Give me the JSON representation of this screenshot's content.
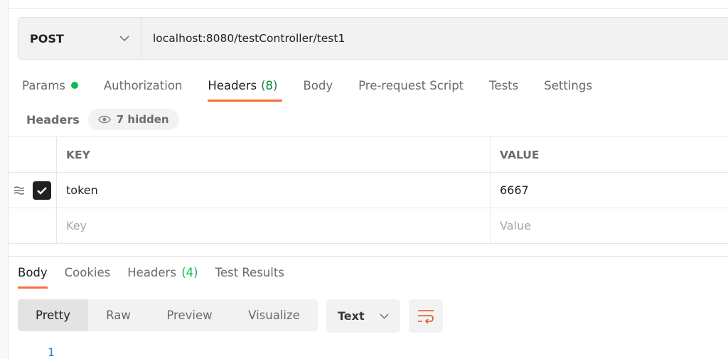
{
  "request": {
    "method": "POST",
    "url": "localhost:8080/testController/test1"
  },
  "tabs": [
    {
      "label": "Params"
    },
    {
      "label": "Authorization"
    },
    {
      "label": "Headers",
      "count": "(8)"
    },
    {
      "label": "Body"
    },
    {
      "label": "Pre-request Script"
    },
    {
      "label": "Tests"
    },
    {
      "label": "Settings"
    }
  ],
  "headers_section": {
    "label": "Headers",
    "hidden": "7 hidden"
  },
  "table": {
    "key_header": "KEY",
    "value_header": "VALUE",
    "rows": [
      {
        "key": "token",
        "value": "6667",
        "checked": true
      }
    ],
    "key_placeholder": "Key",
    "value_placeholder": "Value"
  },
  "response": {
    "tabs": [
      {
        "label": "Body"
      },
      {
        "label": "Cookies"
      },
      {
        "label": "Headers",
        "count": "(4)"
      },
      {
        "label": "Test Results"
      }
    ],
    "views": [
      "Pretty",
      "Raw",
      "Preview",
      "Visualize"
    ],
    "format": "Text",
    "line_number": "1"
  },
  "colors": {
    "accent": "#ff6c37",
    "green": "#0cbb52"
  }
}
